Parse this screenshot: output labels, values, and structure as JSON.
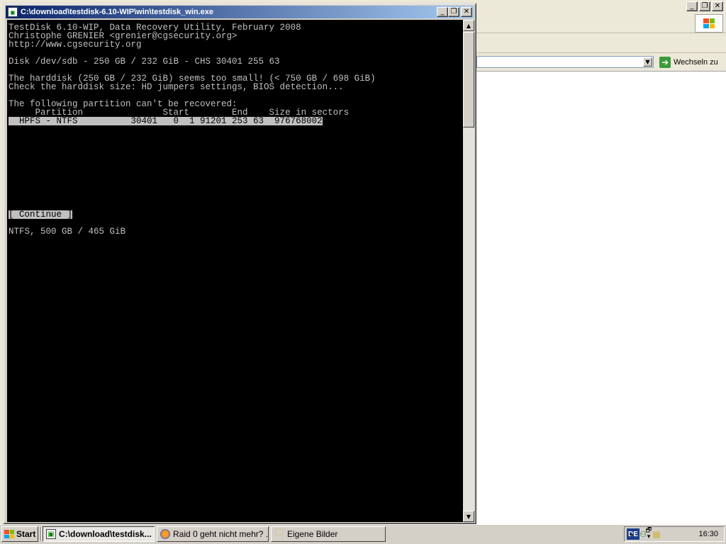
{
  "console": {
    "title": "C:\\download\\testdisk-6.10-WIP\\win\\testdisk_win.exe",
    "lines": {
      "l0": "TestDisk 6.10-WIP, Data Recovery Utility, February 2008",
      "l1": "Christophe GRENIER <grenier@cgsecurity.org>",
      "l2": "http://www.cgsecurity.org",
      "l4": "Disk /dev/sdb - 250 GB / 232 GiB - CHS 30401 255 63",
      "l6": "The harddisk (250 GB / 232 GiB) seems too small! (< 750 GB / 698 GiB)",
      "l7": "Check the harddisk size: HD jumpers settings, BIOS detection...",
      "l9": "The following partition can't be recovered:",
      "l10": "     Partition               Start        End    Size in sectors",
      "l11": "  HPFS - NTFS          30401   0  1 91201 253 63  976768002",
      "l22": "[ Continue ]",
      "l24": "NTFS, 500 GB / 465 GiB"
    }
  },
  "background_window": {
    "go_button_label": "Wechseln zu",
    "address_value": ""
  },
  "taskbar": {
    "start_label": "Start",
    "tasks": [
      {
        "label": "C:\\download\\testdisk...",
        "icon": "console-icon",
        "active": true
      },
      {
        "label": "Raid 0 geht nicht mehr? ...",
        "icon": "firefox-icon",
        "active": false
      },
      {
        "label": "Eigene Bilder",
        "icon": "folder-icon",
        "active": false
      }
    ],
    "language": "DE",
    "tray_chevron": "«",
    "clock": "16:30"
  },
  "colors": {
    "console_bg": "#000000",
    "console_fg": "#c0c0c0",
    "titlebar_start": "#0a246a",
    "titlebar_end": "#a6caf0",
    "lang_badge": "#1c3d8c"
  }
}
